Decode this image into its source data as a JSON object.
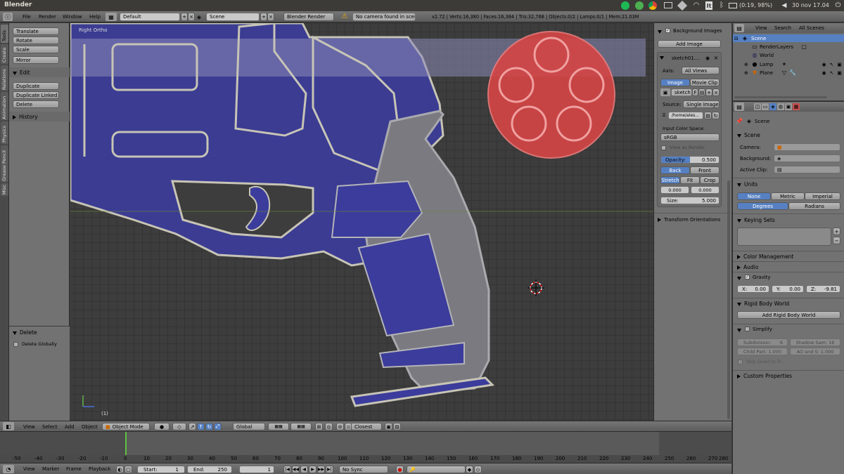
{
  "app": {
    "title": "Blender"
  },
  "system_tray": {
    "battery": "(0:19, 98%)",
    "clock": "30 nov 17.04"
  },
  "infobar": {
    "menus": [
      "File",
      "Render",
      "Window",
      "Help"
    ],
    "layout": "Default",
    "scene": "Scene",
    "render_engine": "Blender Render",
    "warning": "No camera found in scene",
    "stats": "v2.72 | Verts:16,380 | Faces:16,384 | Tris:32,768 | Objects:0/2 | Lamps:0/1 | Mem:21.03M"
  },
  "toolshelf": {
    "tabs": [
      "Tools",
      "Create",
      "Relations",
      "Animation",
      "Physics",
      "Grease Pencil",
      "Misc"
    ],
    "transform_buttons": [
      "Translate",
      "Rotate",
      "Scale"
    ],
    "mirror": "Mirror",
    "edit_header": "Edit",
    "edit_buttons": [
      "Duplicate",
      "Duplicate Linked",
      "Delete"
    ],
    "history_header": "History",
    "operator_header": "Delete",
    "operator_option": "Delete Globally"
  },
  "viewport": {
    "view_label": "Right Ortho",
    "frame_label": "(1)"
  },
  "properties_n": {
    "bg_images_header": "Background Images",
    "add_image": "Add Image",
    "image_name": "sketch01....",
    "axis_label": "Axis:",
    "axis_value": "All Views",
    "tab_image": "Image",
    "tab_movie": "Movie Clip",
    "datablock": "sketch",
    "datablock_flag": "F",
    "source_label": "Source:",
    "source_value": "Single Image",
    "filepath": "/home/ales...",
    "color_space_label": "Input Color Space:",
    "color_space_value": "sRGB",
    "view_as_render": "View as Render",
    "opacity_label": "Opacity:",
    "opacity_value": "0.500",
    "back": "Back",
    "front": "Front",
    "stretch": "Stretch",
    "fit": "Fit",
    "crop": "Crop",
    "offset_x": "0.000",
    "offset_y": "0.000",
    "size_label": "Size:",
    "size_value": "5.000",
    "transform_orient": "Transform Orientations"
  },
  "outliner": {
    "menus": [
      "View",
      "Search",
      "All Scenes"
    ],
    "items": [
      "Scene",
      "RenderLayers",
      "World",
      "Lamp",
      "Plane"
    ]
  },
  "properties": {
    "breadcrumb": "Scene",
    "scene_header": "Scene",
    "camera_label": "Camera:",
    "background_label": "Background:",
    "active_clip_label": "Active Clip:",
    "units_header": "Units",
    "unit_systems": [
      "None",
      "Metric",
      "Imperial"
    ],
    "rotation_units": [
      "Degrees",
      "Radians"
    ],
    "keying_header": "Keying Sets",
    "color_mgmt": "Color Management",
    "audio": "Audio",
    "gravity": "Gravity",
    "gravity_x": "X:",
    "gravity_x_val": "0.00",
    "gravity_y": "Y:",
    "gravity_y_val": "0.00",
    "gravity_z": "Z:",
    "gravity_z_val": "-9.81",
    "rigid_header": "Rigid Body World",
    "add_rigid": "Add Rigid Body World",
    "simplify": "Simplify",
    "subdivision": "Subdivision:",
    "subdivision_val": "6",
    "shadow_samples": "Shadow Sam: 16",
    "child_part": "Child Part: 1.000",
    "ao_sss": "AO and S: 1.000",
    "skip_quad": "Skip Quad to Tr...",
    "custom_props": "Custom Properties"
  },
  "view3d_header": {
    "menus": [
      "View",
      "Select",
      "Add",
      "Object"
    ],
    "mode": "Object Mode",
    "orientation": "Global",
    "snap": "Closest"
  },
  "timeline": {
    "ruler": [
      "-50",
      "-40",
      "-30",
      "-20",
      "-10",
      "0",
      "10",
      "20",
      "30",
      "40",
      "50",
      "60",
      "70",
      "80",
      "90",
      "100",
      "110",
      "120",
      "130",
      "140",
      "150",
      "160",
      "170",
      "180",
      "190",
      "200",
      "210",
      "220",
      "230",
      "240",
      "250",
      "260",
      "270",
      "280"
    ],
    "menus": [
      "View",
      "Marker",
      "Frame",
      "Playback"
    ],
    "start_label": "Start:",
    "start_val": "1",
    "end_label": "End:",
    "end_val": "250",
    "current": "1",
    "sync": "No Sync"
  }
}
